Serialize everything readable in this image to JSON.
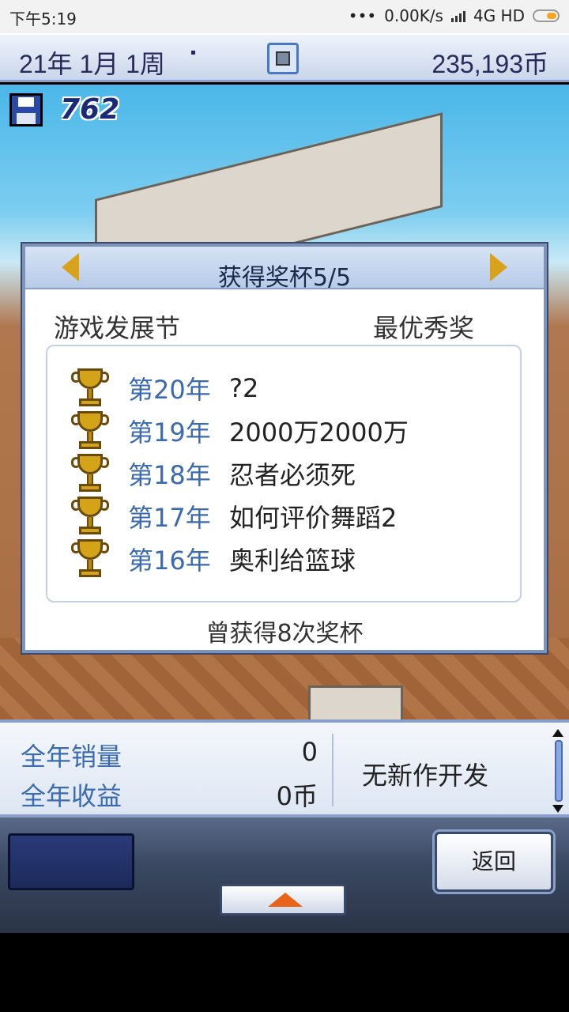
{
  "status_bar": {
    "time": "下午5:19",
    "dots": "•••",
    "network_speed": "0.00K/s",
    "network_type": "4G HD"
  },
  "top_bar": {
    "date": "21年 1月 1周",
    "money": "235,193币"
  },
  "save": {
    "count": "762"
  },
  "award_dialog": {
    "title": "获得奖杯5/5",
    "event_name": "游戏发展节",
    "award_name": "最优秀奖",
    "awards": [
      {
        "year": "第20年",
        "game": "?2"
      },
      {
        "year": "第19年",
        "game": "2000万2000万"
      },
      {
        "year": "第18年",
        "game": "忍者必须死"
      },
      {
        "year": "第17年",
        "game": "如何评价舞蹈2"
      },
      {
        "year": "第16年",
        "game": "奥利给篮球"
      }
    ],
    "total_text": "曾获得8次奖杯"
  },
  "stats": {
    "sales_label": "全年销量",
    "sales_value": "0",
    "revenue_label": "全年收益",
    "revenue_value": "0币",
    "dev_status": "无新作开发"
  },
  "controls": {
    "back_label": "返回"
  },
  "colors": {
    "accent_blue": "#3a6ab0",
    "trophy_gold": "#d4a418",
    "arrow_gold": "#d9a21a",
    "menu_arrow_orange": "#e8641a"
  }
}
